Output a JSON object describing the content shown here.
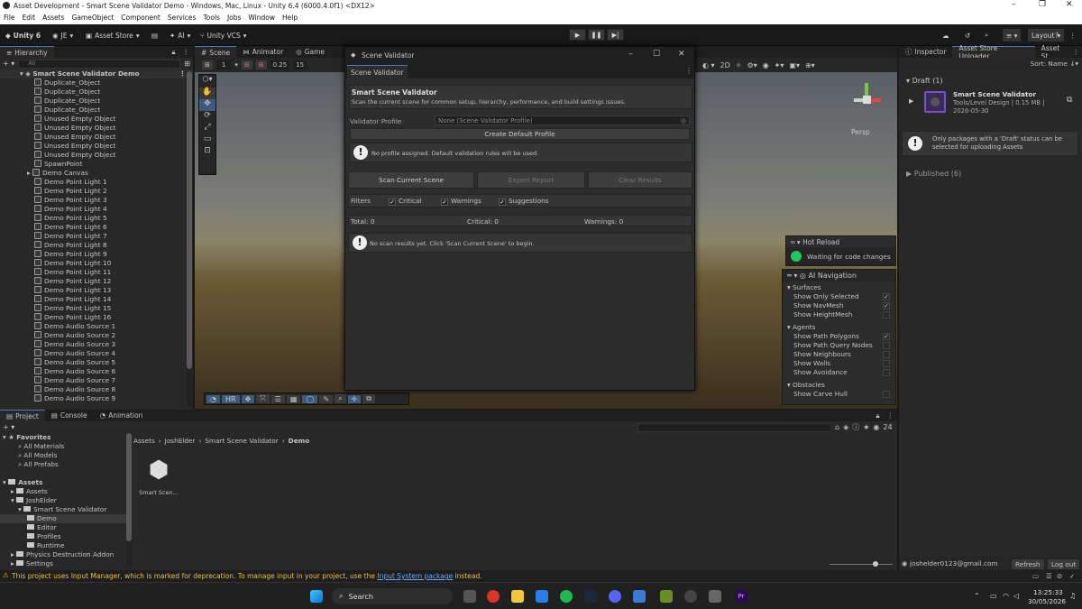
{
  "window": {
    "title": "Asset Development - Smart Scene Validator Demo - Windows, Mac, Linux - Unity 6.4 (6000.4.0f1) <DX12>"
  },
  "menu": [
    "File",
    "Edit",
    "Assets",
    "GameObject",
    "Component",
    "Services",
    "Tools",
    "Jobs",
    "Window",
    "Help"
  ],
  "toolbar": {
    "unity": "Unity 6",
    "account": "JE",
    "asset_store": "Asset Store",
    "ai": "AI",
    "vcs": "Unity VCS",
    "layout": "Layout"
  },
  "hierarchy": {
    "tab": "Hierarchy",
    "search_placeholder": "All",
    "root": "Smart Scene Validator Demo",
    "items": [
      "Duplicate_Object",
      "Duplicate_Object",
      "Duplicate_Object",
      "Duplicate_Object",
      "Unused Empty Object",
      "Unused Empty Object",
      "Unused Empty Object",
      "Unused Empty Object",
      "Unused Empty Object",
      "SpawnPoint",
      "Demo Canvas",
      "Demo Point Light 1",
      "Demo Point Light 2",
      "Demo Point Light 3",
      "Demo Point Light 4",
      "Demo Point Light 5",
      "Demo Point Light 6",
      "Demo Point Light 7",
      "Demo Point Light 8",
      "Demo Point Light 9",
      "Demo Point Light 10",
      "Demo Point Light 11",
      "Demo Point Light 12",
      "Demo Point Light 13",
      "Demo Point Light 14",
      "Demo Point Light 15",
      "Demo Point Light 16",
      "Demo Audio Source 1",
      "Demo Audio Source 2",
      "Demo Audio Source 3",
      "Demo Audio Source 4",
      "Demo Audio Source 5",
      "Demo Audio Source 6",
      "Demo Audio Source 7",
      "Demo Audio Source 8",
      "Demo Audio Source 9"
    ]
  },
  "scene_tabs": {
    "scene": "Scene",
    "animator": "Animator",
    "game": "Game"
  },
  "scene_toolbar": {
    "val1": "1",
    "val2": "0.25",
    "val3": "15",
    "persp": "Persp"
  },
  "bottom_tools": {
    "hr": "HR"
  },
  "dialog": {
    "window_title": "Scene Validator",
    "tab": "Scene Validator",
    "heading": "Smart Scene Validator",
    "description": "Scan the current scene for common setup, hierarchy, performance, and build settings issues.",
    "profile_label": "Validator Profile",
    "profile_value": "None (Scene Validator Profile)",
    "create_profile": "Create Default Profile",
    "no_profile_msg": "No profile assigned. Default validation rules will be used.",
    "scan": "Scan Current Scene",
    "export": "Export Report",
    "clear": "Clear Results",
    "filters_label": "Filters",
    "filter_critical": "Critical",
    "filter_warnings": "Warnings",
    "filter_suggestions": "Suggestions",
    "total": "Total: 0",
    "critical": "Critical: 0",
    "warnings": "Warnings: 0",
    "no_results": "No scan results yet. Click 'Scan Current Scene' to begin."
  },
  "hot_reload": {
    "title": "Hot Reload",
    "status": "Waiting for code changes"
  },
  "ai_nav": {
    "title": "AI Navigation",
    "surfaces": "Surfaces",
    "s_items": [
      "Show Only Selected",
      "Show NavMesh",
      "Show HeightMesh"
    ],
    "agents": "Agents",
    "a_items": [
      "Show Path Polygons",
      "Show Path Query Nodes",
      "Show Neighbours",
      "Show Walls",
      "Show Avoidance"
    ],
    "obstacles": "Obstacles",
    "o_items": [
      "Show Carve Hull"
    ]
  },
  "inspector": {
    "tab1": "Inspector",
    "tab2": "Asset Store Uploader",
    "tab3": "Asset St",
    "sort": "Sort: Name",
    "draft": "Draft (1)",
    "pkg_name": "Smart Scene Validator",
    "pkg_cat": "Tools/Level Design | 0.15 MB |",
    "pkg_date": "2026-05-30",
    "info": "Only packages with a 'Draft' status can be selected for uploading Assets",
    "published": "Published (6)",
    "email": "joshelder0123@gmail.com",
    "refresh": "Refresh",
    "logout": "Log out"
  },
  "project": {
    "tabs": [
      "Project",
      "Console",
      "Animation"
    ],
    "favorites": "Favorites",
    "fav_items": [
      "All Materials",
      "All Models",
      "All Prefabs"
    ],
    "assets": "Assets",
    "tree": [
      "Assets",
      "JoshElder",
      "Smart Scene Validator",
      "Demo",
      "Editor",
      "Profiles",
      "Runtime",
      "Physics Destruction Addon",
      "Settings"
    ],
    "breadcrumb": [
      "Assets",
      "JoshElder",
      "Smart Scene Validator",
      "Demo"
    ],
    "file": "Smart Scen...",
    "count": "24"
  },
  "status": {
    "msg_pre": "This project uses Input Manager, which is marked for deprecation. To manage input in your project, use the ",
    "link": "Input System package",
    "msg_post": " instead."
  },
  "taskbar": {
    "search": "Search",
    "time": "13:25:33",
    "date": "30/05/2026"
  }
}
